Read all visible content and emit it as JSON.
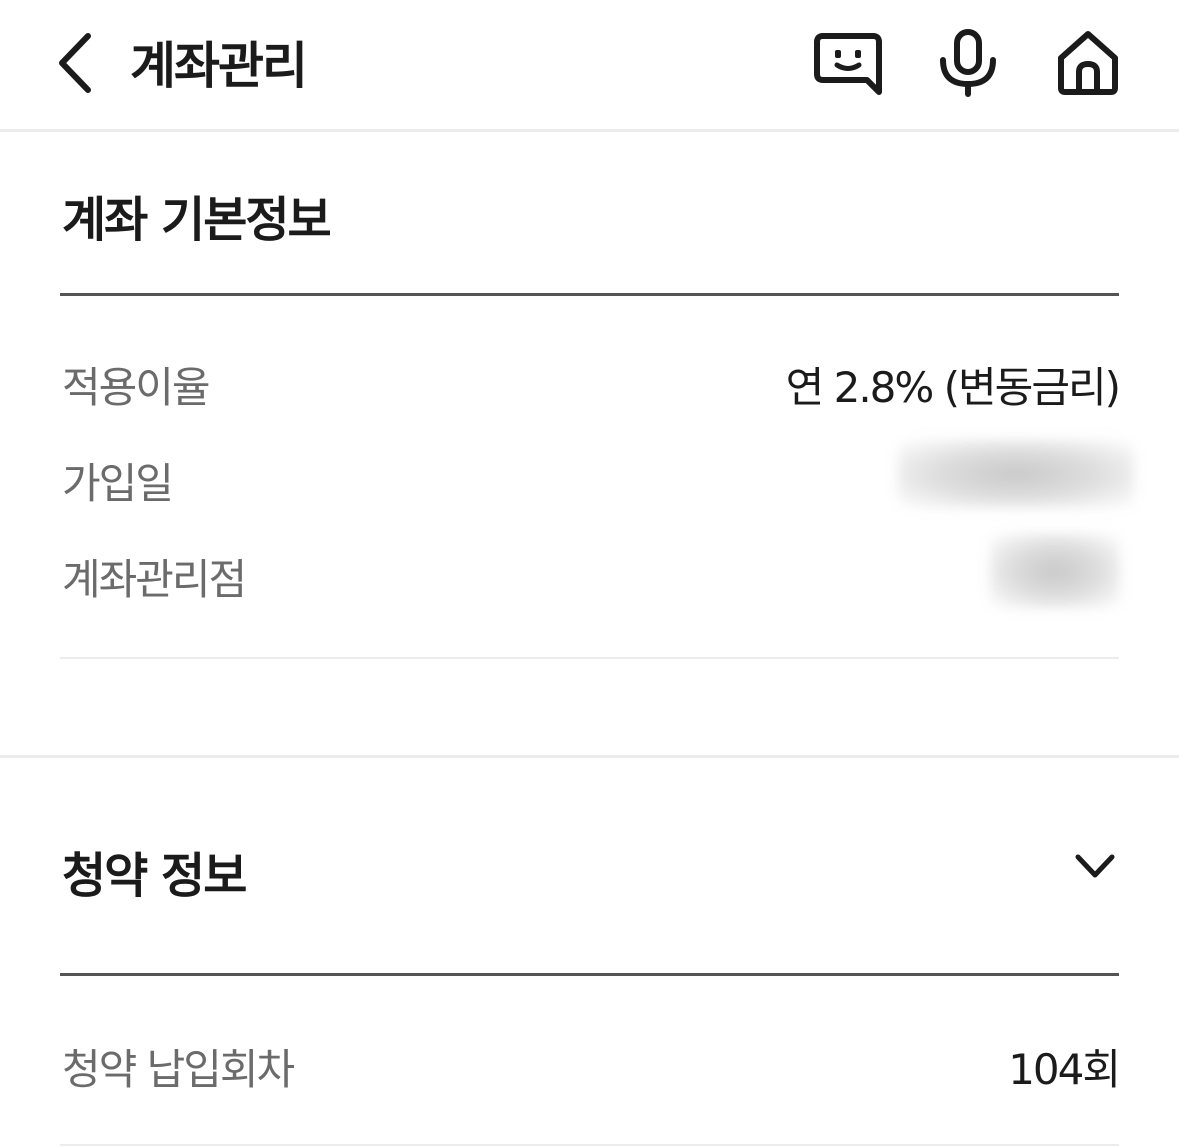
{
  "header": {
    "title": "계좌관리",
    "icons": [
      "back-arrow-icon",
      "chatbot-icon",
      "mic-icon",
      "home-icon"
    ]
  },
  "basic_info": {
    "title": "계좌 기본정보",
    "rows": [
      {
        "label": "적용이율",
        "value": "연 2.8% (변동금리)"
      },
      {
        "label": "가입일",
        "value": ""
      },
      {
        "label": "계좌관리점",
        "value": ""
      }
    ]
  },
  "subscription_info": {
    "title": "청약 정보",
    "rows": [
      {
        "label": "청약 납입회차",
        "value": "104회"
      }
    ]
  },
  "colors": {
    "text_primary": "#1b1b1b",
    "text_secondary": "#6b6b6b",
    "divider": "#ececec",
    "section_rule": "#555555"
  }
}
